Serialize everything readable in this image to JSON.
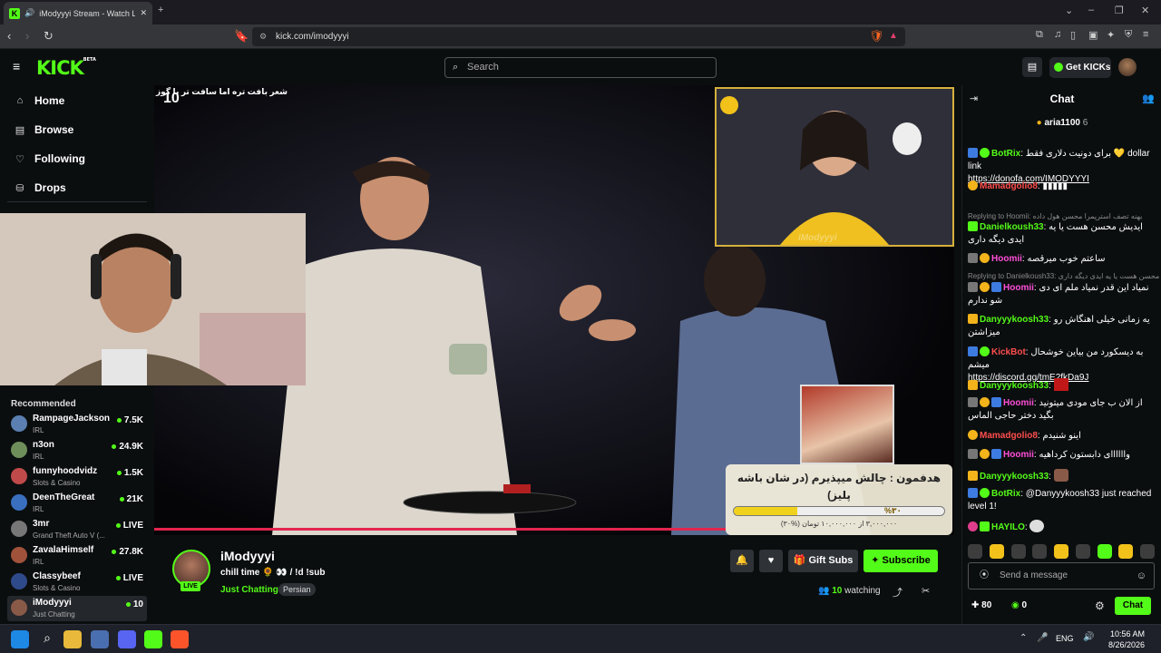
{
  "browser": {
    "tab_title": "iModyyyi Stream - Watch Live",
    "url": "kick.com/imodyyyi"
  },
  "header": {
    "logo": "KICK",
    "logo_tag": "BETA",
    "search_placeholder": "Search",
    "get_kicks_label": "Get KICKs"
  },
  "sidebar": {
    "nav": [
      {
        "label": "Home",
        "icon": "home-icon"
      },
      {
        "label": "Browse",
        "icon": "browse-icon"
      },
      {
        "label": "Following",
        "icon": "heart-icon"
      },
      {
        "label": "Drops",
        "icon": "drops-icon"
      }
    ],
    "recommended_title": "Recommended",
    "recommended": [
      {
        "name": "RampageJackson",
        "category": "IRL",
        "viewers": "7.5K"
      },
      {
        "name": "n3on",
        "category": "IRL",
        "viewers": "24.9K"
      },
      {
        "name": "funnyhoodvidz",
        "category": "Slots & Casino",
        "viewers": "1.5K"
      },
      {
        "name": "DeenTheGreat",
        "category": "IRL",
        "viewers": "21K"
      },
      {
        "name": "3mr",
        "category": "Grand Theft Auto V (...",
        "viewers": "LIVE"
      },
      {
        "name": "ZavalaHimself",
        "category": "IRL",
        "viewers": "27.8K"
      },
      {
        "name": "Classybeef",
        "category": "Slots & Casino",
        "viewers": "LIVE"
      },
      {
        "name": "iModyyyi",
        "category": "Just Chatting",
        "viewers": "10"
      }
    ]
  },
  "video": {
    "overlay_text": "شعر بافت تره اما سافت تر با گوز",
    "overlay_count": "10",
    "cam2_label": "iModyyyi",
    "goal_text": "هدفمون : چالش میپذیرم (در شان باشه پلیز)",
    "goal_percent": "%۳۰",
    "goal_progress": 0.3,
    "goal_sub": "۳,۰۰۰,۰۰۰ از ۱۰,۰۰۰,۰۰۰ تومان (%۳۰)"
  },
  "stream": {
    "streamer": "iModyyyi",
    "live_label": "LIVE",
    "title": "chill time 🌻 👀 / !d !sub",
    "category": "Just Chatting",
    "tag": "Persian",
    "gift_subs_label": "Gift Subs",
    "subscribe_label": "Subscribe",
    "watching_count": "10",
    "watching_label": "watching"
  },
  "chat": {
    "title": "Chat",
    "pinned_user": "aria1100",
    "pinned_count": "6",
    "messages": [
      {
        "user": "BotRix",
        "color": "#53fc18",
        "text": "برای دونیت دلاری فقط 💛 dollar link",
        "link": "https://donofa.com/IMODYYYI"
      },
      {
        "user": "Mamadgolio8",
        "color": "#ff4d4d",
        "text": ""
      },
      {
        "reply": "Replying to Hoomii: بهنه تصف استرپمرا محسن هول داده"
      },
      {
        "user": "Danielkoush33",
        "color": "#53fc18",
        "text": "ایدیش محسن هست یا یه ایدی دیگه داری"
      },
      {
        "user": "Hoomii",
        "color": "#ff4fd8",
        "text": "ساعتم خوب میرقصه"
      },
      {
        "reply": "Replying to Danielkoush33: محسن هست یا یه ایدی دیگه داری"
      },
      {
        "user": "Hoomii",
        "color": "#ff4fd8",
        "text": "نمیاد این قدر نمیاد ملم ای دی شو ندارم"
      },
      {
        "user": "Danyyykoosh33",
        "color": "#53fc18",
        "text": "یه زمانی خیلی اهنگاش رو میزاشتن"
      },
      {
        "user": "KickBot",
        "color": "#ff4d4d",
        "text": "به دیسکورد من بیاین خوشحال میشم",
        "link": "https://discord.gg/tmE2fkDa9J"
      },
      {
        "user": "Danyyykoosh33",
        "color": "#53fc18",
        "text": ""
      },
      {
        "user": "Hoomii",
        "color": "#ff4fd8",
        "text": "از الان ب جای مودی میتونید بگید دختر حاجی الماس"
      },
      {
        "user": "Mamadgolio8",
        "color": "#ff4d4d",
        "text": "اینو شنیدم"
      },
      {
        "user": "Hoomii",
        "color": "#ff4fd8",
        "text": "واااااای دابستون کرداهیه"
      },
      {
        "user": "Danyyykoosh33",
        "color": "#53fc18",
        "text": ""
      },
      {
        "user": "BotRix",
        "color": "#53fc18",
        "text": "@Danyyykoosh33 just reached level 1!"
      },
      {
        "user": "HAYILO",
        "color": "#53fc18",
        "text": ""
      }
    ],
    "send_placeholder": "Send a message",
    "points": "80",
    "kicks": "0",
    "chat_button": "Chat"
  },
  "taskbar": {
    "lang": "ENG",
    "time": "10:56 AM",
    "date": "8/26/2026"
  }
}
